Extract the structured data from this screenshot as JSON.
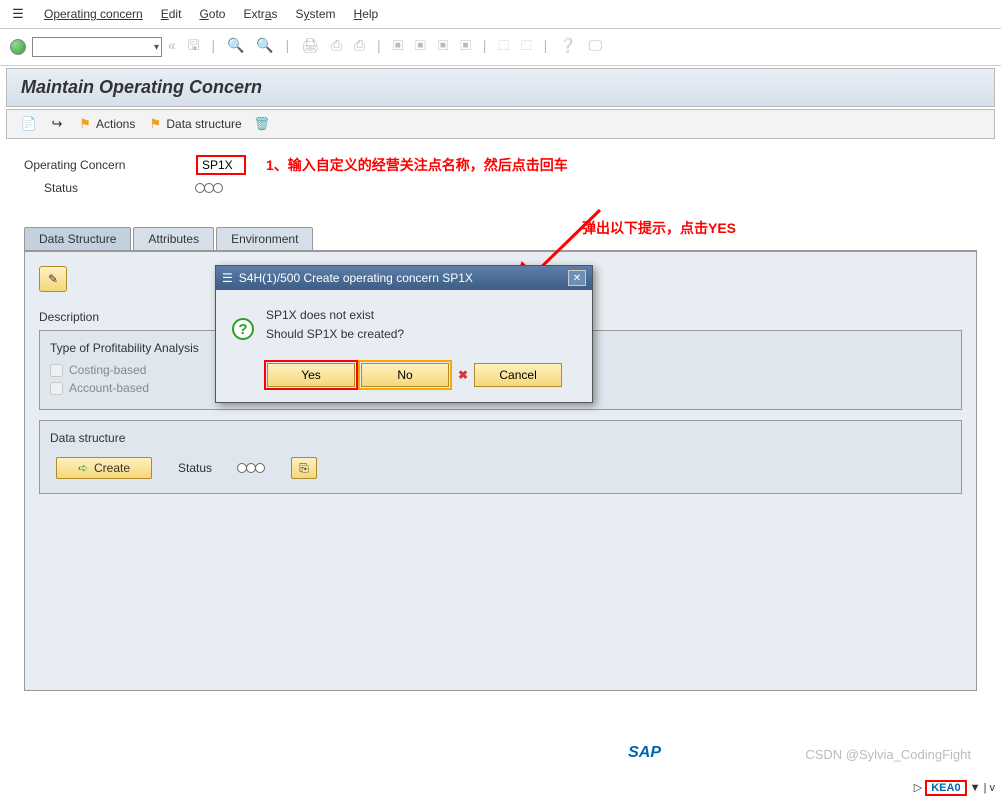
{
  "menu": {
    "i0": "Operating concern",
    "i1": "Edit",
    "i2": "Goto",
    "i3": "Extras",
    "i4": "System",
    "i5": "Help"
  },
  "title": "Maintain Operating Concern",
  "actionbar": {
    "actions": "Actions",
    "datastruct": "Data structure"
  },
  "form": {
    "concern_label": "Operating Concern",
    "concern_value": "SP1X",
    "status_label": "Status"
  },
  "annotations": {
    "a1": "1、输入自定义的经营关注点名称，然后点击回车",
    "a2": "弹出以下提示，点击YES"
  },
  "tabs": {
    "t0": "Data Structure",
    "t1": "Attributes",
    "t2": "Environment"
  },
  "panel": {
    "description": "Description",
    "group1_title": "Type of Profitability Analysis",
    "chk1": "Costing-based",
    "chk2": "Account-based",
    "group2_title": "Data structure",
    "create": "Create",
    "status": "Status"
  },
  "dialog": {
    "title": "S4H(1)/500 Create operating concern SP1X",
    "line1": "SP1X does not exist",
    "line2": "Should SP1X be created?",
    "yes": "Yes",
    "no": "No",
    "cancel": "Cancel"
  },
  "footer": {
    "watermark": "CSDN @Sylvia_CodingFight",
    "tcode": "KEA0",
    "logo": "SAP"
  }
}
